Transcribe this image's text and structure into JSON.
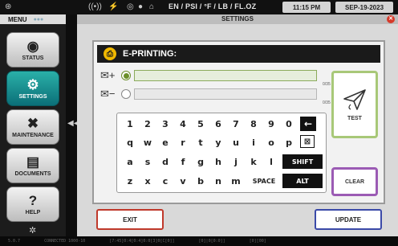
{
  "topbar": {
    "units": "EN / PSI / °F / LB / FL.OZ",
    "time": "11:15 PM",
    "date": "SEP-19-2023",
    "icons": [
      "menu-icon",
      "wifi-icon",
      "network-icon",
      "print-icon",
      "camera-icon",
      "home-icon"
    ]
  },
  "sidebar": {
    "title": "MENU",
    "items": [
      {
        "label": "STATUS",
        "icon": "gauge-icon",
        "glyph": "◉"
      },
      {
        "label": "SETTINGS",
        "icon": "gear-icon",
        "glyph": "⚙"
      },
      {
        "label": "MAINTENANCE",
        "icon": "tools-icon",
        "glyph": "✖"
      },
      {
        "label": "DOCUMENTS",
        "icon": "document-icon",
        "glyph": "▤"
      },
      {
        "label": "HELP",
        "icon": "help-icon",
        "glyph": "?"
      }
    ]
  },
  "main": {
    "title": "SETTINGS",
    "panel_title": "E-PRINTING:",
    "fields": [
      {
        "value": "",
        "count": "0/35",
        "selected": true
      },
      {
        "value": "",
        "count": "0/35",
        "selected": false
      }
    ],
    "keyboard": {
      "row1": [
        "1",
        "2",
        "3",
        "4",
        "5",
        "6",
        "7",
        "8",
        "9",
        "0"
      ],
      "row2": [
        "q",
        "w",
        "e",
        "r",
        "t",
        "y",
        "u",
        "i",
        "o",
        "p"
      ],
      "row3": [
        "a",
        "s",
        "d",
        "f",
        "g",
        "h",
        "j",
        "k",
        "l"
      ],
      "row4": [
        "z",
        "x",
        "c",
        "v",
        "b",
        "n",
        "m"
      ],
      "space": "SPACE",
      "shift": "SHIFT",
      "alt": "ALT",
      "backspace": "←",
      "delete": "⊠"
    },
    "test_label": "TEST",
    "clear_label": "CLEAR",
    "exit_label": "EXIT",
    "update_label": "UPDATE",
    "accent_test": "#a8c878",
    "accent_clear": "#9b5bb4",
    "accent_exit": "#c0392b",
    "accent_update": "#3b4aa8"
  },
  "status": {
    "text": [
      "5.0.7",
      "CONNECTED 1000-10",
      "[7:45]0:4[0:4]0:0[3]0[C[0]]",
      "[0]|0[0:0]]",
      "[0][00]"
    ]
  }
}
